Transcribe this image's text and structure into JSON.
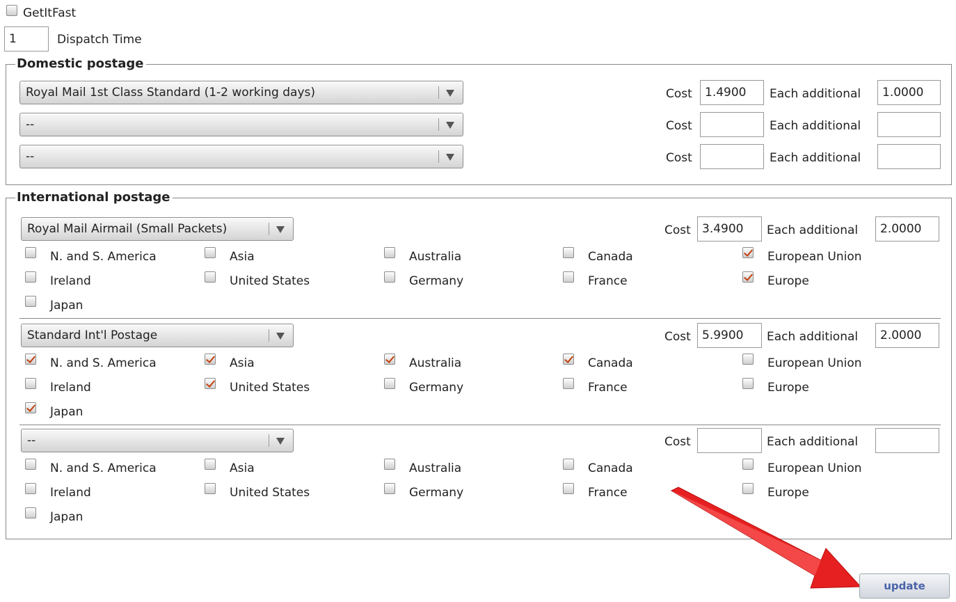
{
  "getitfast": {
    "label": "GetItFast",
    "checked": false
  },
  "dispatch": {
    "value": "1",
    "label": "Dispatch Time"
  },
  "domestic": {
    "legend": "Domestic postage",
    "cost_label": "Cost",
    "each_label": "Each additional",
    "rows": [
      {
        "service": "Royal Mail 1st Class Standard (1-2 working days)",
        "cost": "1.4900",
        "each": "1.0000"
      },
      {
        "service": "--",
        "cost": "",
        "each": ""
      },
      {
        "service": "--",
        "cost": "",
        "each": ""
      }
    ]
  },
  "international": {
    "legend": "International postage",
    "cost_label": "Cost",
    "each_label": "Each additional",
    "regions": [
      "N. and S. America",
      "Asia",
      "Australia",
      "Canada",
      "European Union",
      "Ireland",
      "United States",
      "Germany",
      "France",
      "Europe",
      "Japan"
    ],
    "rows": [
      {
        "service": "Royal Mail Airmail (Small Packets)",
        "cost": "3.4900",
        "each": "2.0000",
        "checked": [
          false,
          false,
          false,
          false,
          true,
          false,
          false,
          false,
          false,
          true,
          false
        ]
      },
      {
        "service": "Standard Int'l Postage",
        "cost": "5.9900",
        "each": "2.0000",
        "checked": [
          true,
          true,
          true,
          true,
          false,
          false,
          true,
          false,
          false,
          false,
          true
        ]
      },
      {
        "service": "--",
        "cost": "",
        "each": "",
        "checked": [
          false,
          false,
          false,
          false,
          false,
          false,
          false,
          false,
          false,
          false,
          false
        ]
      }
    ]
  },
  "update_label": "update",
  "colors": {
    "check_accent": "#c2410c",
    "arrow": "#e02020",
    "button_text": "#4a63a8"
  }
}
